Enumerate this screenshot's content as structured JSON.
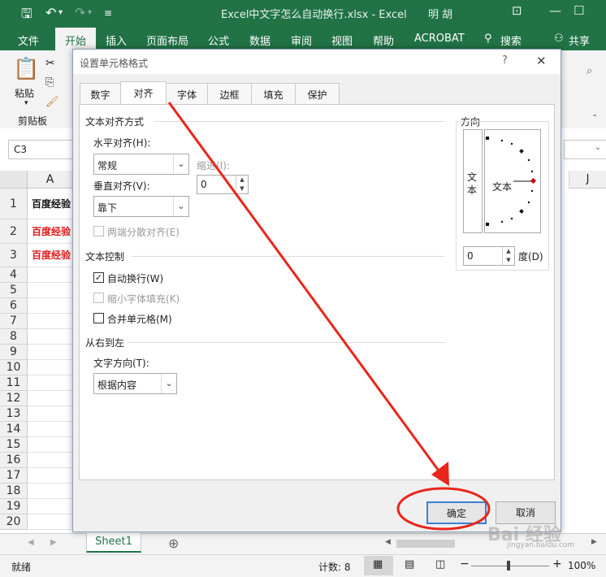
{
  "titlebar": {
    "title": "Excel中文字怎么自动换行.xlsx  -  Excel",
    "user": "明 胡",
    "save_icon": "save-icon",
    "undo_icon": "undo-icon",
    "redo_icon": "redo-icon"
  },
  "ribbon_tabs": [
    "文件",
    "开始",
    "插入",
    "页面布局",
    "公式",
    "数据",
    "审阅",
    "视图",
    "帮助",
    "ACROBAT",
    "搜索",
    "共享"
  ],
  "ribbon": {
    "paste": "粘贴",
    "clipboard": "剪贴板"
  },
  "namebox": "C3",
  "grid": {
    "col_a": "A",
    "col_j": "J",
    "rows": [
      "1",
      "2",
      "3",
      "4",
      "5",
      "6",
      "7",
      "8",
      "9",
      "10",
      "11",
      "12",
      "13",
      "14",
      "15",
      "16",
      "17",
      "18",
      "19",
      "20"
    ],
    "cell_text": "百度经验"
  },
  "sheet_tab": "Sheet1",
  "status": {
    "ready": "就绪",
    "count": "计数: 8",
    "zoom": "100%"
  },
  "watermark": "Bai 经验",
  "watermark_url": "jingyan.baidu.com",
  "dialog": {
    "title": "设置单元格格式",
    "help": "?",
    "close": "✕",
    "tabs": [
      "数字",
      "对齐",
      "字体",
      "边框",
      "填充",
      "保护"
    ],
    "active_tab": "对齐",
    "text_alignment": "文本对齐方式",
    "horizontal_label": "水平对齐(H):",
    "horizontal_value": "常规",
    "indent_label": "缩进(I):",
    "indent_value": "0",
    "vertical_label": "垂直对齐(V):",
    "vertical_value": "靠下",
    "distributed": "两端分散对齐(E)",
    "text_control": "文本控制",
    "wrap_text": "自动换行(W)",
    "shrink_fit": "缩小字体填充(K)",
    "merge_cells": "合并单元格(M)",
    "rtl": "从右到左",
    "text_direction_label": "文字方向(T):",
    "text_direction_value": "根据内容",
    "orientation": "方向",
    "vertical_text": "文本",
    "orient_text": "文本",
    "degrees_value": "0",
    "degrees_label": "度(D)",
    "ok": "确定",
    "cancel": "取消"
  },
  "annotation_color": "#e8261b"
}
